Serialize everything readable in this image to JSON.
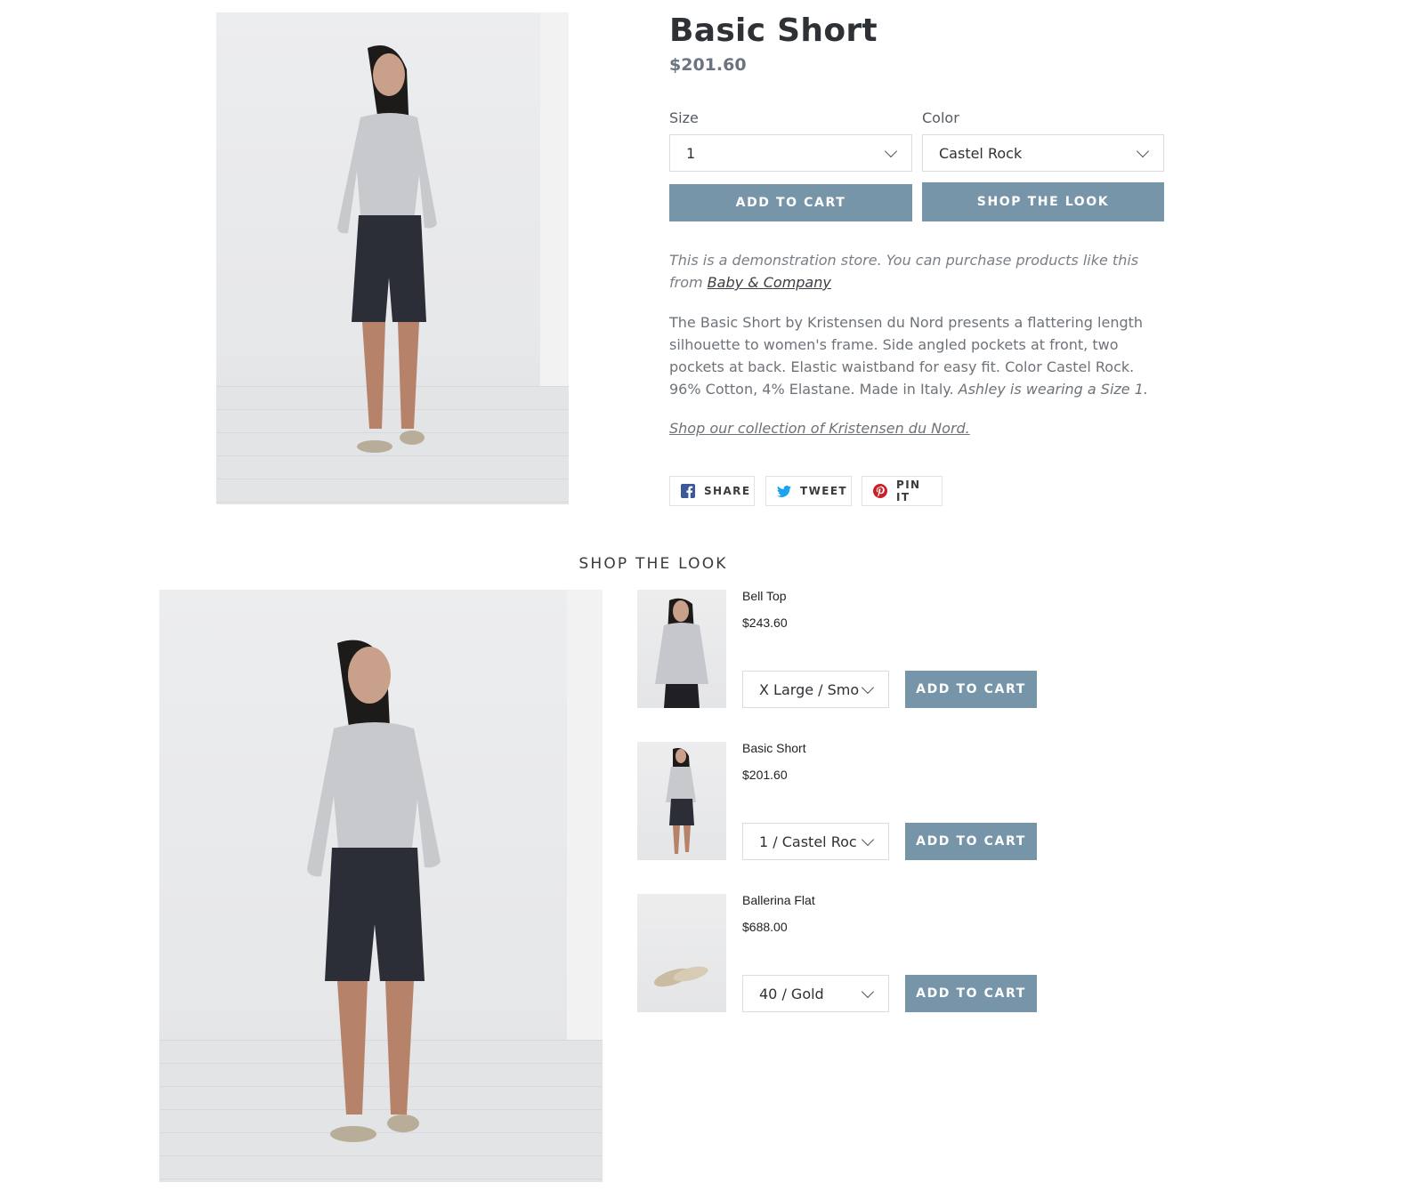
{
  "product": {
    "title": "Basic Short",
    "price": "$201.60",
    "size_label": "Size",
    "size_value": "1",
    "color_label": "Color",
    "color_value": "Castel Rock",
    "add_to_cart_label": "ADD TO CART",
    "shop_the_look_label": "SHOP THE LOOK",
    "note_prefix": "This is a demonstration store. You can purchase products like this from ",
    "note_link": "Baby & Company",
    "description": "The Basic Short by Kristensen du Nord presents a flattering length silhouette to women's frame. Side angled pockets at front, two pockets at back. Elastic waistband for easy fit. Color Castel Rock. 96% Cotton, 4% Elastane. Made in Italy. ",
    "description_italic": "Ashley is wearing a Size 1.",
    "collection_link": "Shop our collection of Kristensen du Nord."
  },
  "share": {
    "facebook_label": "SHARE",
    "twitter_label": "TWEET",
    "pinterest_label": "PIN IT"
  },
  "shop_the_look": {
    "heading": "SHOP THE LOOK",
    "items": [
      {
        "name": "Bell Top",
        "price": "$243.60",
        "variant": "X Large / Smo",
        "button": "ADD TO CART"
      },
      {
        "name": "Basic Short",
        "price": "$201.60",
        "variant": "1 / Castel Roc",
        "button": "ADD TO CART"
      },
      {
        "name": "Ballerina Flat",
        "price": "$688.00",
        "variant": "40 / Gold",
        "button": "ADD TO CART"
      }
    ]
  },
  "icons": [
    "facebook-icon",
    "twitter-icon",
    "pinterest-icon",
    "chevron-down-icon"
  ],
  "colors": {
    "button": "#7795a9",
    "facebook": "#3b5998",
    "twitter": "#1da1f2",
    "pinterest": "#cb2027"
  }
}
